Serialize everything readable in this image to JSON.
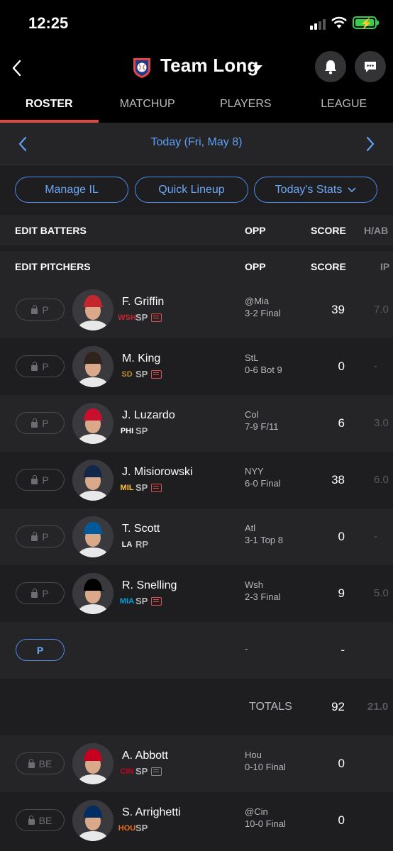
{
  "status": {
    "time": "12:25"
  },
  "header": {
    "team_name": "Team Long"
  },
  "tabs": [
    "ROSTER",
    "MATCHUP",
    "PLAYERS",
    "LEAGUE"
  ],
  "date": "Today (Fri, May 8)",
  "buttons": {
    "manage_il": "Manage IL",
    "quick_lineup": "Quick Lineup",
    "todays_stats": "Today's Stats"
  },
  "batters_header": {
    "title": "EDIT BATTERS",
    "opp": "OPP",
    "score": "SCORE",
    "extra": "H/AB"
  },
  "pitchers_header": {
    "title": "EDIT PITCHERS",
    "opp": "OPP",
    "score": "SCORE",
    "extra": "IP"
  },
  "pitchers": [
    {
      "slot": "P",
      "name": "F. Griffin",
      "team": "WSH",
      "team_color": "#c4262e",
      "pos": "SP",
      "news": "red",
      "opp": "@Mia",
      "result": "3-2 Final",
      "score": "39",
      "ip": "7.0",
      "cap": "#c4262e"
    },
    {
      "slot": "P",
      "name": "M. King",
      "team": "SD",
      "team_color": "#b8912f",
      "pos": "SP",
      "news": "red",
      "opp": "StL",
      "result": "0-6 Bot 9",
      "score": "0",
      "ip": "-",
      "cap": "#2f241d"
    },
    {
      "slot": "P",
      "name": "J. Luzardo",
      "team": "PHI",
      "team_color": "#ffffff",
      "pos": "SP",
      "news": "",
      "opp": "Col",
      "result": "7-9 F/11",
      "score": "6",
      "ip": "3.0",
      "cap": "#c8102e"
    },
    {
      "slot": "P",
      "name": "J. Misiorowski",
      "team": "MIL",
      "team_color": "#ffc52f",
      "pos": "SP",
      "news": "red",
      "opp": "NYY",
      "result": "6-0 Final",
      "score": "38",
      "ip": "6.0",
      "cap": "#12284b"
    },
    {
      "slot": "P",
      "name": "T. Scott",
      "team": "LA",
      "team_color": "#ffffff",
      "pos": "RP",
      "news": "",
      "opp": "Atl",
      "result": "3-1 Top 8",
      "score": "0",
      "ip": "-",
      "cap": "#005a9c"
    },
    {
      "slot": "P",
      "name": "R. Snelling",
      "team": "MIA",
      "team_color": "#00a3e0",
      "pos": "SP",
      "news": "red",
      "opp": "Wsh",
      "result": "2-3 Final",
      "score": "9",
      "ip": "5.0",
      "cap": "#000000"
    }
  ],
  "empty_slot": {
    "slot": "P",
    "opp": "-",
    "score": "-"
  },
  "totals": {
    "label": "TOTALS",
    "score": "92",
    "ip": "21.0"
  },
  "bench": [
    {
      "slot": "BE",
      "name": "A. Abbott",
      "team": "CIN",
      "team_color": "#c6011f",
      "pos": "SP",
      "news": "gray",
      "opp": "Hou",
      "result": "0-10 Final",
      "score": "0",
      "ip": "",
      "cap": "#c6011f"
    },
    {
      "slot": "BE",
      "name": "S. Arrighetti",
      "team": "HOU",
      "team_color": "#eb6e1f",
      "pos": "SP",
      "news": "",
      "opp": "@Cin",
      "result": "10-0 Final",
      "score": "0",
      "ip": "",
      "cap": "#002d62"
    }
  ]
}
